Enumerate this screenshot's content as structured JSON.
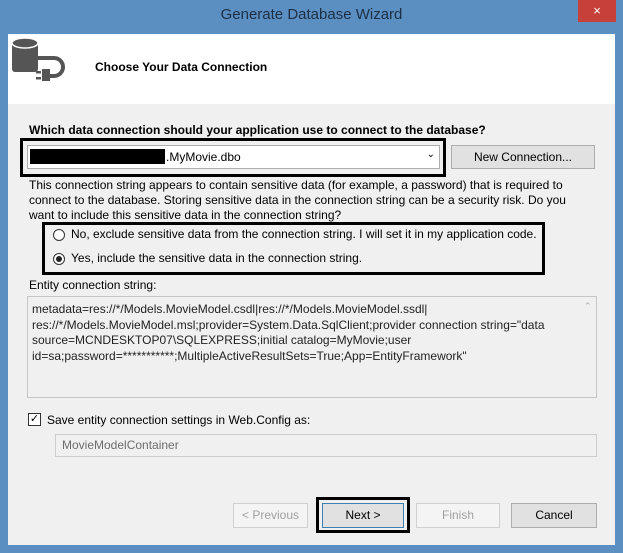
{
  "window": {
    "title": "Generate Database Wizard",
    "close_icon": "×"
  },
  "header": {
    "title": "Choose Your Data Connection"
  },
  "connection": {
    "question": "Which data connection should your application use to connect to the database?",
    "selected": ".MyMovie.dbo",
    "new_connection_label": "New Connection...",
    "warning": "This connection string appears to contain sensitive data (for example, a password) that is required to connect to the database. Storing sensitive data in the connection string can be a security risk. Do you want to include this sensitive data in the connection string?",
    "option_exclude": "No, exclude sensitive data from the connection string. I will set it in my application code.",
    "option_include": "Yes, include the sensitive data in the connection string.",
    "selected_option": "include"
  },
  "entity": {
    "label": "Entity connection string:",
    "value": "metadata=res://*/Models.MovieModel.csdl|res://*/Models.MovieModel.ssdl|\nres://*/Models.MovieModel.msl;provider=System.Data.SqlClient;provider connection string=\"data\nsource=MCNDESKTOP07\\SQLEXPRESS;initial catalog=MyMovie;user\nid=sa;password=***********;MultipleActiveResultSets=True;App=EntityFramework\"",
    "save_label": "Save entity connection settings in Web.Config as:",
    "save_checked": true,
    "container_name": "MovieModelContainer"
  },
  "footer": {
    "previous": "< Previous",
    "next": "Next >",
    "finish": "Finish",
    "cancel": "Cancel"
  }
}
